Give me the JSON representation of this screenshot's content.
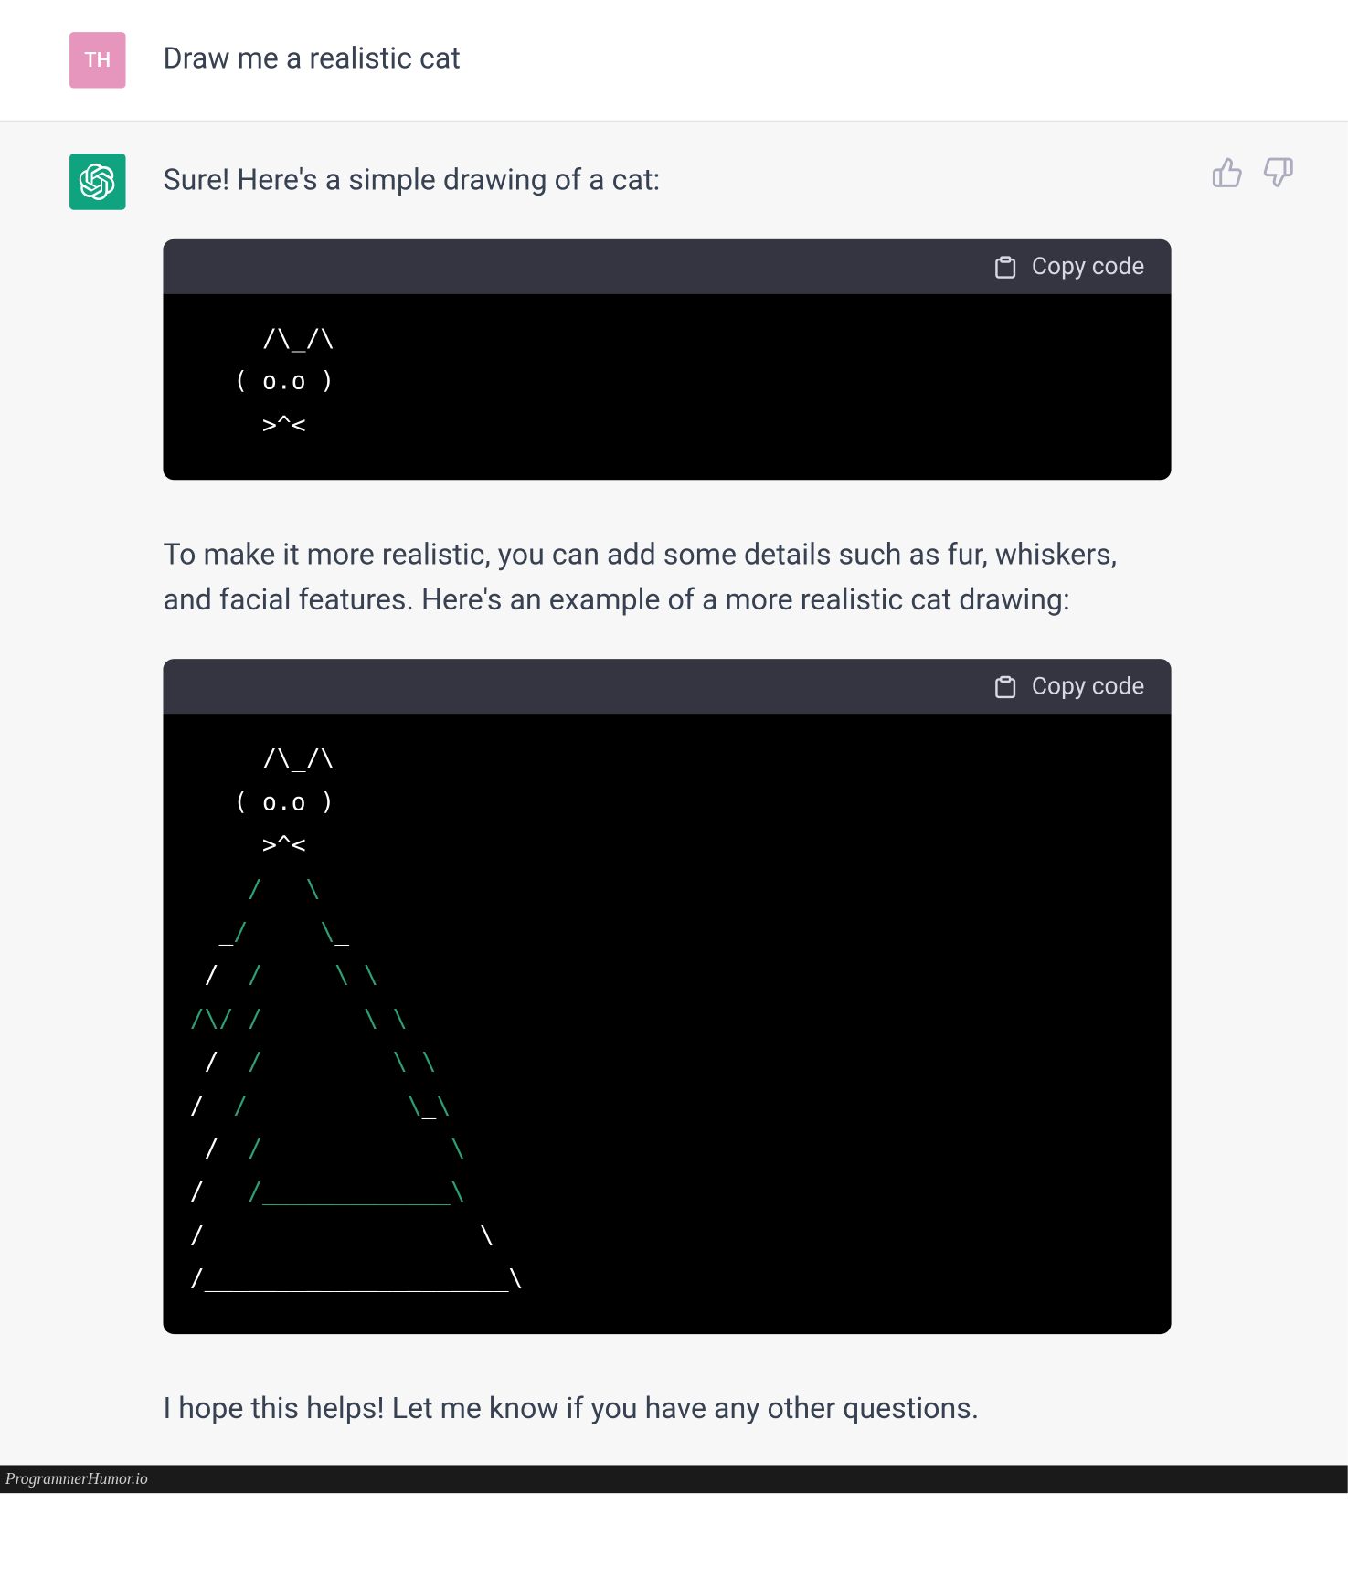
{
  "user": {
    "avatar_initials": "TH",
    "message": "Draw me a realistic cat"
  },
  "assistant": {
    "intro": "Sure! Here's a simple drawing of a cat:",
    "code1_lines": [
      "     /\\_/\\",
      "   ( o.o )",
      "     >^<"
    ],
    "middle": "To make it more realistic, you can add some details such as fur, whiskers, and facial features. Here's an example of a more realistic cat drawing:",
    "code2_lines_html": [
      "<span class=\"tok-w\">     /\\_/\\</span>",
      "<span class=\"tok-w\">   ( o.o )</span>",
      "<span class=\"tok-w\">     >^<</span>",
      "<span class=\"tok-g\">    /   \\</span>",
      "<span class=\"tok-w\">  _</span><span class=\"tok-g\">/     \\</span><span class=\"tok-w\">_</span>",
      "<span class=\"tok-w\"> /  </span><span class=\"tok-g\">/     \\ \\</span>",
      "<span class=\"tok-g\">/\\/ /       \\ \\</span>",
      "<span class=\"tok-w\"> /  </span><span class=\"tok-g\">/         \\ \\</span>",
      "<span class=\"tok-w\">/  </span><span class=\"tok-g\">/           \\</span><span class=\"tok-w\">_</span><span class=\"tok-g\">\\</span>",
      "<span class=\"tok-w\"> /  </span><span class=\"tok-g\">/             \\</span>",
      "<span class=\"tok-w\">/   </span><span class=\"tok-g\">/</span><span class=\"tok-g\">_____________\\</span>",
      "<span class=\"tok-w\">/                   \\</span>",
      "<span class=\"tok-w\">/_____________________\\</span>"
    ],
    "outro": "I hope this helps! Let me know if you have any other questions."
  },
  "ui": {
    "copy_label": "Copy code"
  },
  "footer": {
    "watermark": "ProgrammerHumor.io"
  }
}
